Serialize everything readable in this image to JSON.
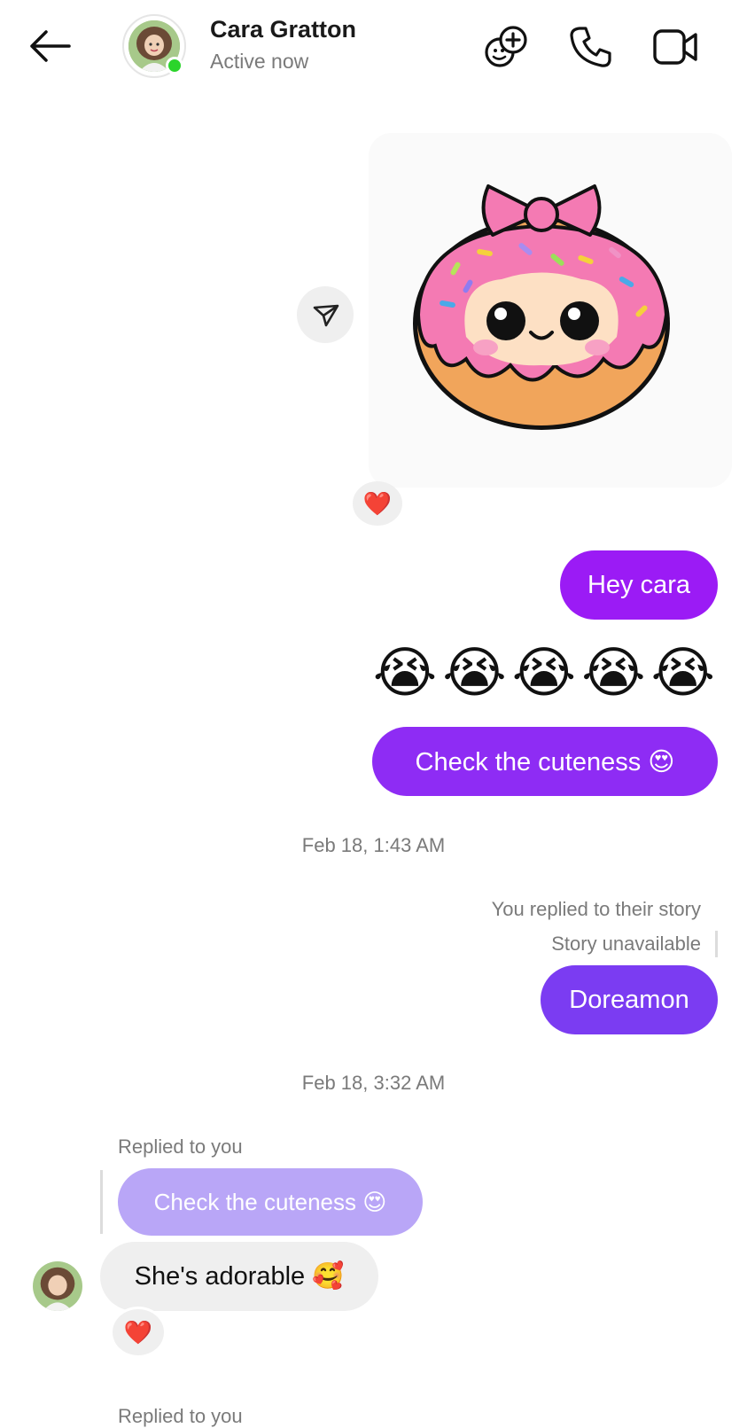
{
  "header": {
    "contact_name": "Cara Gratton",
    "status": "Active now",
    "icons": [
      "back-arrow-icon",
      "add-people-icon",
      "phone-icon",
      "video-icon"
    ]
  },
  "messages": {
    "sticker_reaction": "❤️",
    "m1": "Hey cara",
    "m2": "😭😭😭😭😭",
    "m3": "Check the cuteness 😍",
    "ts1": "Feb 18, 1:43 AM",
    "story_reply_label": "You replied to their story",
    "story_unavailable": "Story unavailable",
    "m4": "Doreamon",
    "ts2": "Feb 18, 3:32 AM",
    "replied_label": "Replied to you",
    "quoted": "Check the cuteness 😍",
    "m5": "She's adorable 🥰",
    "m5_reaction": "❤️",
    "cut_label": "Replied to you"
  },
  "colors": {
    "outgoing_bubble": "#9b1bf5",
    "outgoing_bubble_alt": "#7b3cf2",
    "quoted_bubble": "#b9a6f7",
    "incoming_bubble": "#efefef",
    "online_dot": "#2bd42b"
  }
}
